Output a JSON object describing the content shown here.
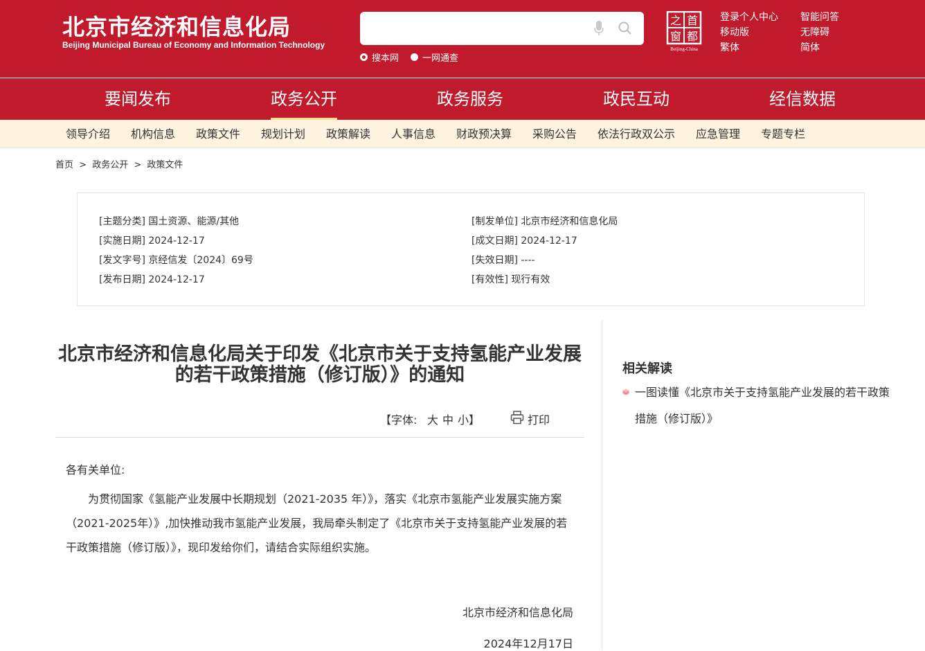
{
  "header": {
    "title_cn": "北京市经济和信息化局",
    "title_en": "Beijing Municipal Bureau of Economy and Information Technology",
    "search": {
      "placeholder": "",
      "scope_site": "搜本网",
      "scope_all": "一网通查"
    },
    "seal": {
      "chars": [
        "之",
        "首",
        "窗",
        "都"
      ],
      "caption": "Beijing-China"
    },
    "links_left": [
      "登录个人中心",
      "移动版",
      "繁体"
    ],
    "links_right": [
      "智能问答",
      "无障碍",
      "简体"
    ],
    "brand_color": "#c01a2c"
  },
  "main_nav": [
    "要闻发布",
    "政务公开",
    "政务服务",
    "政民互动",
    "经信数据"
  ],
  "main_nav_active": "政务公开",
  "sub_nav": [
    "领导介绍",
    "机构信息",
    "政策文件",
    "规划计划",
    "政策解读",
    "人事信息",
    "财政预决算",
    "采购公告",
    "依法行政双公示",
    "应急管理",
    "专题专栏"
  ],
  "breadcrumb": [
    "首页",
    ">",
    "政务公开",
    ">",
    "政策文件"
  ],
  "meta": {
    "topic": "[主题分类] 国土资源、能源/其他",
    "issuer": "[制发单位] 北京市经济和信息化局",
    "effective_date": "[实施日期] 2024-12-17",
    "written_date": "[成文日期] 2024-12-17",
    "doc_number": "[发文字号] 京经信发〔2024〕69号",
    "expiry_date": "[失效日期] ----",
    "publish_date": "[发布日期] 2024-12-17",
    "validity": "[有效性] 现行有效"
  },
  "article": {
    "title": "北京市经济和信息化局关于印发《北京市关于支持氢能产业发展的若干政策措施（修订版）》的通知",
    "font_label": "【字体:",
    "font_large": "大",
    "font_medium": "中",
    "font_small": "小】",
    "print_label": "打印",
    "salutation": "各有关单位:",
    "body": "为贯彻国家《氢能产业发展中长期规划（2021-2035 年）》，落实《北京市氢能产业发展实施方案（2021-2025年）》,加快推动我市氢能产业发展，我局牵头制定了《北京市关于支持氢能产业发展的若干政策措施（修订版）》，现印发给你们，请结合实际组织实施。",
    "signature": "北京市经济和信息化局",
    "date": "2024年12月17日"
  },
  "sidebar": {
    "title": "相关解读",
    "items": [
      "一图读懂《北京市关于支持氢能产业发展的若干政策措施（修订版）》"
    ]
  }
}
